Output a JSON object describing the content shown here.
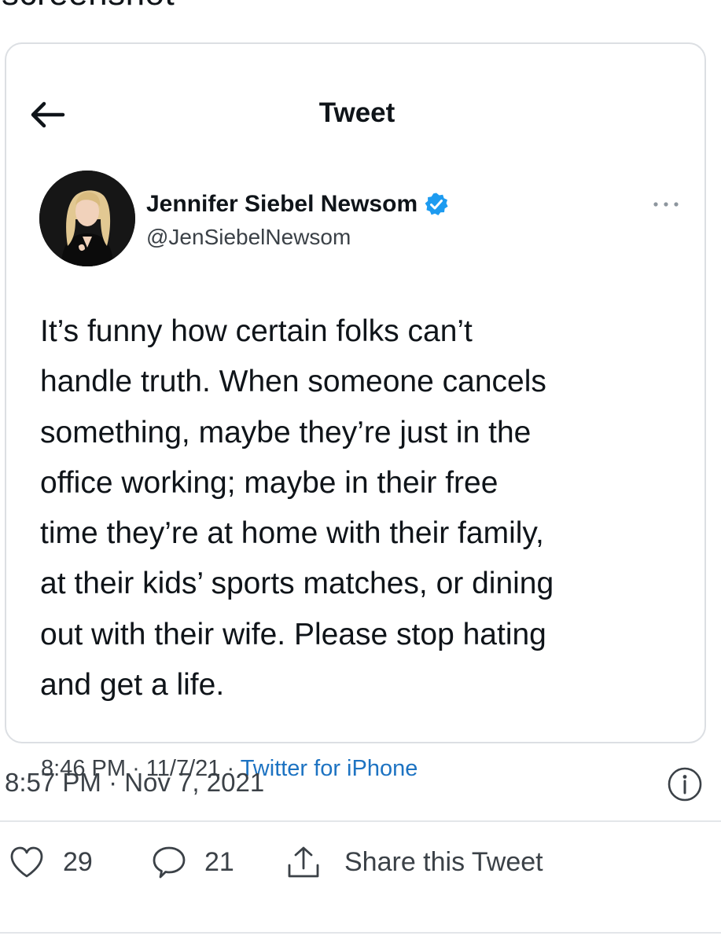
{
  "header_fragment": "screenshot",
  "embed": {
    "title": "Tweet",
    "author": {
      "display_name": "Jennifer Siebel Newsom",
      "handle": "@JenSiebelNewsom",
      "verified": true
    },
    "body_lines": [
      "It’s funny how certain folks can’t",
      "handle truth. When someone cancels",
      "something, maybe they’re just in the",
      "office working; maybe in their free",
      "time they’re at home with their family,",
      "at their kids’ sports matches, or dining",
      "out with their wife. Please stop hating",
      "and get a life."
    ],
    "meta": {
      "time": "8:46 PM",
      "date": "11/7/21",
      "separator": "·",
      "source": "Twitter for iPhone"
    }
  },
  "outer": {
    "timestamp": "8:57 PM · Nov 7, 2021"
  },
  "actions": {
    "likes": "29",
    "replies": "21",
    "share_label": "Share this Tweet"
  },
  "colors": {
    "link": "#1d73c2",
    "verified": "#1d9bf0",
    "text_primary": "#0f1419",
    "text_secondary": "#3b4147",
    "border": "#dcdfe3"
  },
  "icons": [
    "back-arrow-icon",
    "verified-icon",
    "more-icon",
    "info-icon",
    "heart-icon",
    "reply-icon",
    "share-icon"
  ]
}
